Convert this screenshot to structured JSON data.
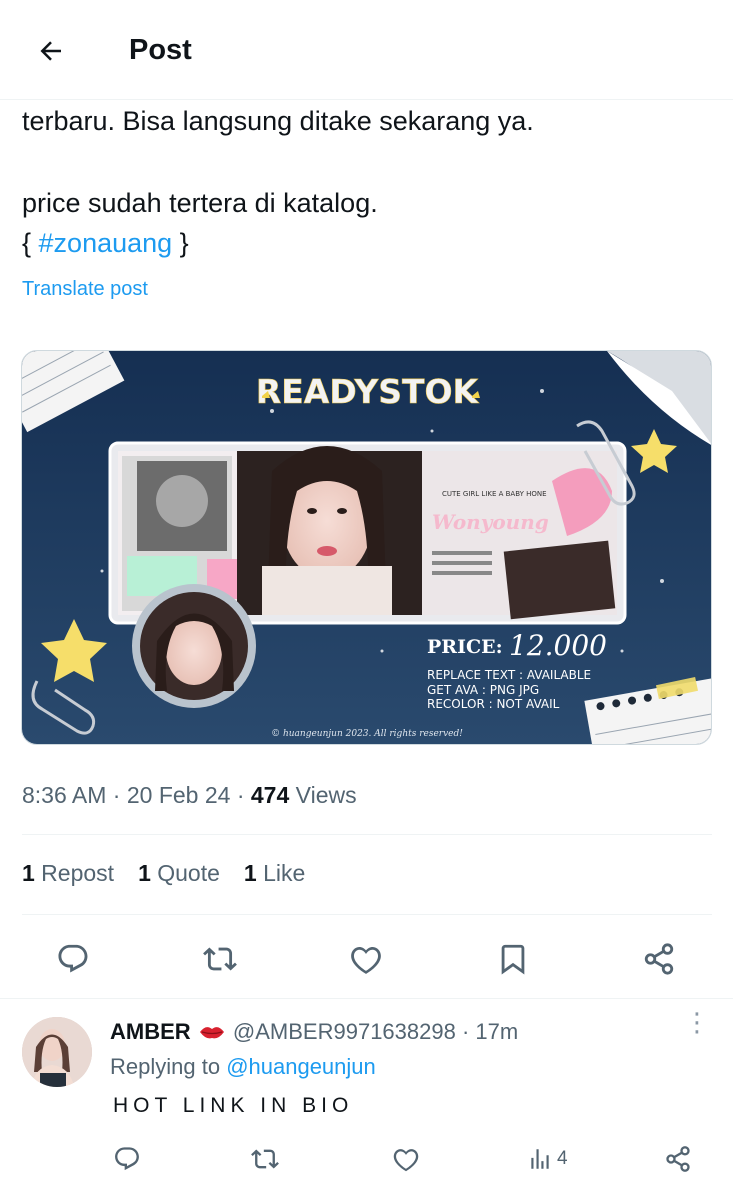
{
  "header": {
    "title": "Post"
  },
  "tweet": {
    "line1": "terbaru. Bisa langsung ditake sekarang ya.",
    "line2": "price sudah tertera di katalog.",
    "brace_open": "{ ",
    "hashtag": "#zonauang",
    "brace_close": " }",
    "translate": "Translate post"
  },
  "media": {
    "banner": "READYSTOK",
    "price_label": "PRICE:",
    "price_value": "12.000",
    "replace_text": "REPLACE TEXT : AVAILABLE",
    "get_ava": "GET AVA : PNG JPG",
    "recolor": "RECOLOR : NOT AVAIL",
    "name_text": "Wonyoung",
    "copyright": "© huangeunjun 2023. All rights reserved!",
    "tagline": "CUTE GIRL LIKE A BABY HONE"
  },
  "meta": {
    "time": "8:36 AM",
    "sep1": " · ",
    "date": "20 Feb 24",
    "sep2": " · ",
    "views_count": "474",
    "views_label": " Views"
  },
  "stats": {
    "reposts_count": "1",
    "reposts_label": " Repost",
    "quotes_count": "1",
    "quotes_label": " Quote",
    "likes_count": "1",
    "likes_label": " Like"
  },
  "reply": {
    "name": "AMBER",
    "handle": " @AMBER9971638298",
    "time": " · 17m",
    "replying_prefix": "Replying to ",
    "replying_handle": "@huangeunjun",
    "text": "HOT LINK IN BIO",
    "views": "4",
    "more": "⋮"
  },
  "icons": {
    "back": "arrow-left-icon",
    "lips": "lips-emoji-icon",
    "reply": "reply-icon",
    "repost": "repost-icon",
    "like": "heart-icon",
    "bookmark": "bookmark-icon",
    "share": "share-icon",
    "views": "analytics-icon"
  },
  "colors": {
    "accent": "#1d9bf0",
    "text": "#0f1419",
    "muted": "#536471",
    "media_bg": "#1b3556"
  }
}
